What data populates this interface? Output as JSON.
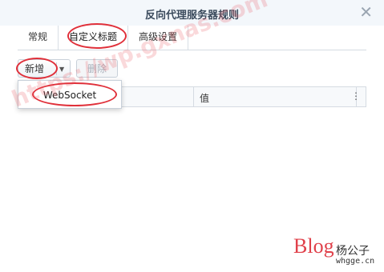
{
  "dialog": {
    "title": "反向代理服务器规则",
    "close_glyph": "✕"
  },
  "tabs": [
    {
      "label": "常规"
    },
    {
      "label": "自定义标题",
      "active": true
    },
    {
      "label": "高级设置"
    }
  ],
  "toolbar": {
    "add_label": "新增",
    "add_caret": "▼",
    "delete_label": "删除"
  },
  "table": {
    "value_header": "值",
    "menu_glyph": "⋮"
  },
  "dropdown": {
    "items": [
      "WebSocket"
    ]
  },
  "watermarks": {
    "diagonal": "https://wp.gxnas.com",
    "blog": "Blog",
    "author": "杨公子",
    "site": "whgge.cn"
  },
  "colors": {
    "annotation_ring": "#e0303a",
    "titlebar_bg": "#f3f7fb"
  }
}
